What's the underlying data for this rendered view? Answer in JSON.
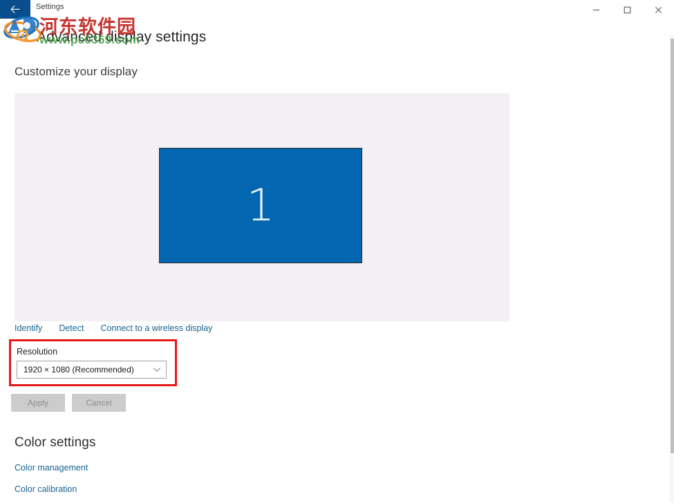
{
  "window": {
    "titlebar_text": "Settings",
    "back_icon": "back-arrow-icon",
    "minimize_label": "─",
    "maximize_label": "□",
    "close_label": "✕"
  },
  "page": {
    "title": "Advanced display settings"
  },
  "watermark": {
    "chinese_text": "河东软件园",
    "url_text": "www.pc0359.com",
    "logo_icon": "globe-logo-icon",
    "chinese_color": "#c1251f",
    "url_color": "#3e9b41"
  },
  "customize": {
    "heading": "Customize your display",
    "monitor_number": "1",
    "monitor_color": "#0366b0",
    "preview_background": "#f2f0f4",
    "links": [
      {
        "label": "Identify",
        "name": "identify-link"
      },
      {
        "label": "Detect",
        "name": "detect-link"
      },
      {
        "label": "Connect to a wireless display",
        "name": "connect-wireless-display-link"
      }
    ],
    "link_color": "#16638f"
  },
  "resolution": {
    "label": "Resolution",
    "selected_value": "1920 × 1080 (Recommended)",
    "chevron_icon": "chevron-down-icon",
    "highlight_color": "#e81717"
  },
  "actions": {
    "apply_label": "Apply",
    "cancel_label": "Cancel",
    "disabled_background": "#cccccc",
    "disabled_text_color": "#8e8e8e"
  },
  "color_settings": {
    "heading": "Color settings",
    "links": [
      {
        "label": "Color management",
        "name": "color-management-link"
      },
      {
        "label": "Color calibration",
        "name": "color-calibration-link"
      }
    ]
  }
}
